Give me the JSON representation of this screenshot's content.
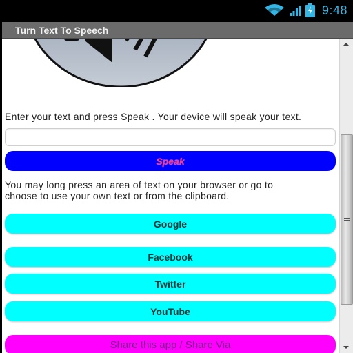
{
  "status_bar": {
    "icons": [
      "wifi-icon",
      "signal-icon",
      "battery-charging-icon"
    ],
    "time": "9:48",
    "accent_color": "#33b5e5"
  },
  "app": {
    "title": "Turn Text To Speech"
  },
  "main": {
    "header_image": "speaker-volume-icon",
    "intro_text": "Enter your text and press Speak . Your device will speak your text.",
    "text_input": {
      "value": "",
      "placeholder": ""
    },
    "speak_button": {
      "label": "Speak",
      "bg_color": "#0000ff",
      "text_color": "#ff3c7a"
    },
    "help_text": {
      "line1": "You may long press an area of text on your browser or go to",
      "line2": "choose to use your own text or from the clipboard."
    },
    "link_buttons": [
      {
        "label": "Google"
      },
      {
        "label": "Facebook"
      },
      {
        "label": "Twitter"
      },
      {
        "label": "YouTube"
      }
    ],
    "link_button_color": "#00ffff",
    "share_button": {
      "label": "Share this app / Share Via",
      "bg_color": "#ff00ff"
    }
  },
  "scrollbar": {
    "position_fraction": 0.35
  }
}
